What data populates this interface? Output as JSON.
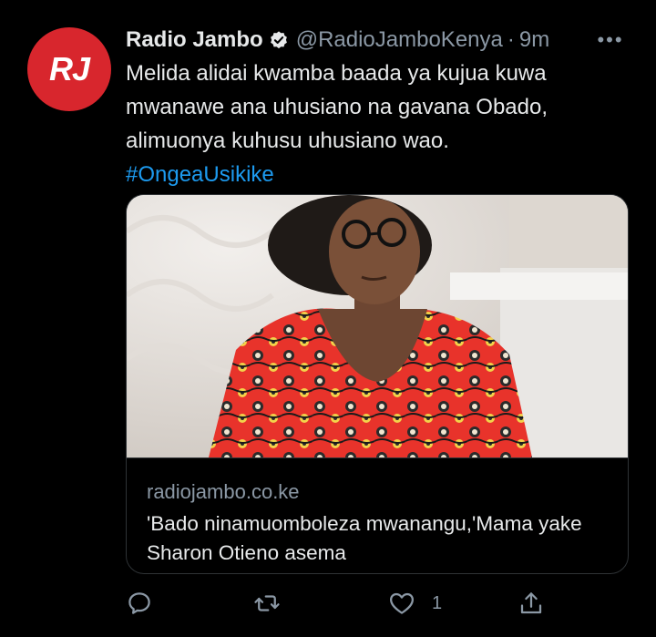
{
  "account": {
    "avatar_text": "RJ",
    "name": "Radio Jambo",
    "handle": "@RadioJamboKenya",
    "separator": "·",
    "time": "9m",
    "verified": true
  },
  "tweet": {
    "line1": "Melida alidai kwamba baada ya kujua kuwa",
    "line2": "mwanawe ana uhusiano na gavana Obado,",
    "line3": "alimuonya kuhusu uhusiano wao.",
    "hashtag": "#OngeaUsikike"
  },
  "card": {
    "domain": "radiojambo.co.ke",
    "title": "'Bado ninamuomboleza mwanangu,'Mama yake Sharon Otieno asema",
    "image_icon": "photo-woman-red-dress"
  },
  "actions": {
    "reply_icon": "reply-icon",
    "retweet_icon": "retweet-icon",
    "like_icon": "like-icon",
    "like_count": "1",
    "share_icon": "share-icon"
  },
  "colors": {
    "background": "#000000",
    "text": "#e7e9ea",
    "secondary": "#8b98a5",
    "link": "#1d9bf0",
    "brand_red": "#d8262d",
    "border": "#2f3336"
  }
}
